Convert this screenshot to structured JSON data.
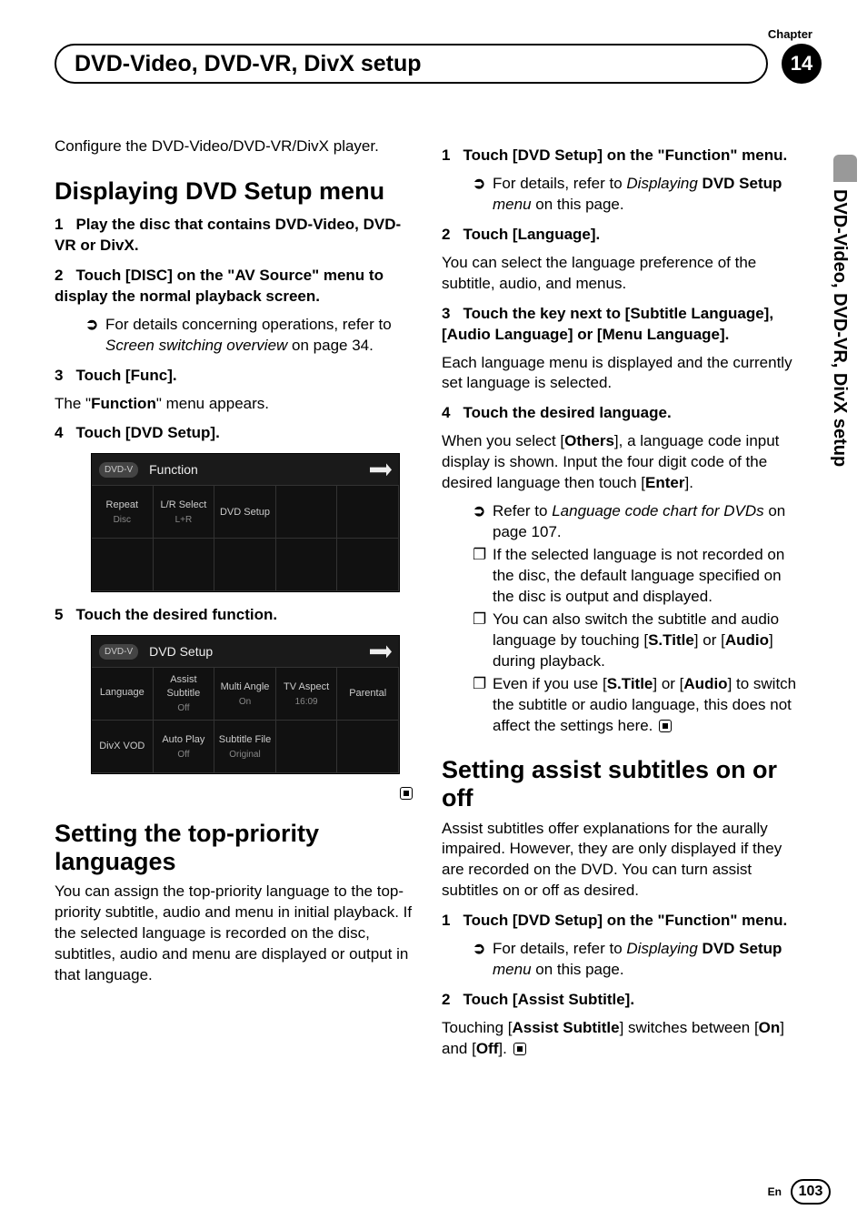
{
  "chapter": {
    "label": "Chapter",
    "number": "14"
  },
  "title": "DVD-Video, DVD-VR, DivX setup",
  "side_tab": "DVD-Video, DVD-VR, DivX setup",
  "footer": {
    "lang": "En",
    "page": "103"
  },
  "left": {
    "intro": "Configure the DVD-Video/DVD-VR/DivX player.",
    "h_display_a": "Displaying ",
    "h_display_b": "DVD Setup",
    "h_display_c": " menu",
    "s1": "Play the disc that contains DVD-Video, DVD-VR or DivX.",
    "s2": "Touch [DISC] on the \"AV Source\" menu to display the normal playback screen.",
    "s2_note": "For details concerning operations, refer to ",
    "s2_note_i": "Screen switching overview",
    "s2_note_end": " on page 34.",
    "s3": "Touch [Func].",
    "s3_sub_a": "The \"",
    "s3_sub_b": "Function",
    "s3_sub_c": "\" menu appears.",
    "s4": "Touch [DVD Setup].",
    "s5": "Touch the desired function.",
    "h_priority": "Setting the top-priority languages",
    "p_priority": "You can assign the top-priority language to the top-priority subtitle, audio and menu in initial playback. If the selected language is recorded on the disc, subtitles, audio and menu are displayed or output in that language.",
    "shot1": {
      "badge": "DVD-V",
      "title": "Function",
      "row1": [
        "Repeat",
        "L/R Select",
        "DVD Setup",
        "",
        ""
      ],
      "row2": [
        "Disc",
        "L+R",
        "",
        "",
        ""
      ]
    },
    "shot2": {
      "badge": "DVD-V",
      "title": "DVD Setup",
      "row1": [
        "Language",
        "Assist Subtitle",
        "Multi Angle",
        "TV Aspect",
        "Parental"
      ],
      "row1v": [
        "",
        "Off",
        "On",
        "16:09",
        ""
      ],
      "row2": [
        "DivX VOD",
        "Auto Play",
        "Subtitle File",
        "",
        ""
      ],
      "row2v": [
        "",
        "Off",
        "Original",
        "",
        ""
      ]
    }
  },
  "right": {
    "s1": "Touch [DVD Setup] on the \"Function\" menu.",
    "s1_note": "For details, refer to ",
    "s1_note_i": "Displaying ",
    "s1_note_b": "DVD Setup",
    "s1_note_i2": " menu",
    "s1_note_end": " on this page.",
    "s2": "Touch [Language].",
    "s2_sub": "You can select the language preference of the subtitle, audio, and menus.",
    "s3": "Touch the key next to [Subtitle Language], [Audio Language] or [Menu Language].",
    "s3_sub": "Each language menu is displayed and the currently set language is selected.",
    "s4": "Touch the desired language.",
    "s4_sub_a": "When you select [",
    "s4_sub_b": "Others",
    "s4_sub_c": "], a language code input display is shown. Input the four digit code of the desired language then touch [",
    "s4_sub_d": "Enter",
    "s4_sub_e": "].",
    "s4_n1a": "Refer to ",
    "s4_n1i": "Language code chart for DVDs",
    "s4_n1b": " on page 107.",
    "s4_n2": "If the selected language is not recorded on the disc, the default language specified on the disc is output and displayed.",
    "s4_n3a": "You can also switch the subtitle and audio language by touching [",
    "s4_n3b": "S.Title",
    "s4_n3c": "] or [",
    "s4_n3d": "Audio",
    "s4_n3e": "] during playback.",
    "s4_n4a": "Even if you use [",
    "s4_n4b": "S.Title",
    "s4_n4c": "] or [",
    "s4_n4d": "Audio",
    "s4_n4e": "] to switch the subtitle or audio language, this does not affect the settings here.",
    "h_assist": "Setting assist subtitles on or off",
    "p_assist": "Assist subtitles offer explanations for the aurally impaired. However, they are only displayed if they are recorded on the DVD. You can turn assist subtitles on or off as desired.",
    "a_s1": "Touch [DVD Setup] on the \"Function\" menu.",
    "a_s1_note": "For details, refer to ",
    "a_s1_note_i": "Displaying ",
    "a_s1_note_b": "DVD Setup",
    "a_s1_note_i2": " menu",
    "a_s1_note_end": " on this page.",
    "a_s2": "Touch [Assist Subtitle].",
    "a_s2_sub_a": "Touching [",
    "a_s2_sub_b": "Assist Subtitle",
    "a_s2_sub_c": "] switches between [",
    "a_s2_sub_d": "On",
    "a_s2_sub_e": "] and [",
    "a_s2_sub_f": "Off",
    "a_s2_sub_g": "]."
  }
}
